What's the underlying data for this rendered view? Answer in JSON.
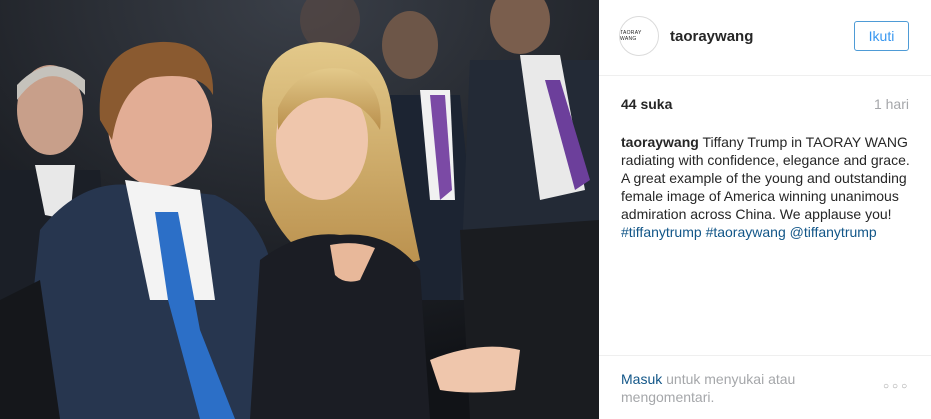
{
  "post": {
    "username": "taoraywang",
    "avatar_text": "TAORAY WANG",
    "follow_label": "Ikuti",
    "likes": "44 suka",
    "time": "1 hari",
    "caption_user": "taoraywang",
    "caption_text": " Tiffany Trump in TAORAY WANG radiating with confidence, elegance and grace. A great example of the young and outstanding female image of America winning unanimous admiration across China. We applause you! ",
    "hashtag_1": "#tiffanytrump",
    "hashtag_2": "#taoraywang",
    "mention": "@tiffanytrump",
    "login_link": "Masuk",
    "login_suffix": " untuk menyukai atau mengomentari.",
    "more_icon": "ellipsis-icon"
  }
}
